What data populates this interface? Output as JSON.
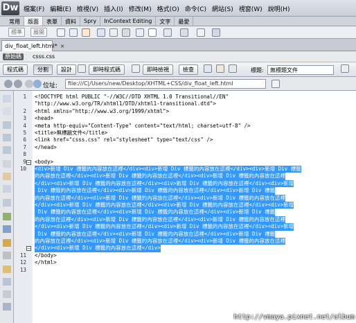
{
  "app": {
    "logo": "Dw"
  },
  "menu": [
    "檔案(F)",
    "編輯(E)",
    "檢視(V)",
    "插入(I)",
    "修改(M)",
    "格式(O)",
    "命令(C)",
    "網站(S)",
    "視窗(W)",
    "說明(H)"
  ],
  "insert_tabs": [
    "常用",
    "版面",
    "表單",
    "資料",
    "Spry",
    "InContext Editing",
    "文字",
    "最愛"
  ],
  "insert_bar": {
    "mode_button": "標準",
    "expand_button": "展開"
  },
  "document_tab": {
    "filename": "div_float_left.html*",
    "close": "×"
  },
  "related_files": {
    "source": "原始碼",
    "css": "csss.css"
  },
  "doc_toolbar": {
    "code": "程式碼",
    "split": "分割",
    "design": "設計",
    "live_code": "即時程式碼",
    "live_view": "即時檢視",
    "inspect": "檢查",
    "title_label": "標題:",
    "title_value": "無標題文件"
  },
  "address": {
    "label": "位址:",
    "value": "file:///C|/Users/new/Desktop/XHTML+CSS/div_float_left.html"
  },
  "code_lines": [
    {
      "n": "1",
      "t": "<!DOCTYPE html PUBLIC \"-//W3C//DTD XHTML 1.0 Transitional//EN\""
    },
    {
      "n": "",
      "t": "\"http://www.w3.org/TR/xhtml1/DTD/xhtml1-transitional.dtd\">"
    },
    {
      "n": "2",
      "t": "<html xmlns=\"http://www.w3.org/1999/xhtml\">"
    },
    {
      "n": "3",
      "t": "<head>"
    },
    {
      "n": "4",
      "t": "<meta http-equiv=\"Content-Type\" content=\"text/html; charset=utf-8\" />"
    },
    {
      "n": "5",
      "t": "<title>無標題文件</title>"
    },
    {
      "n": "6",
      "t": "<link href=\"csss.css\" rel=\"stylesheet\" type=\"text/css\" />"
    },
    {
      "n": "7",
      "t": "</head>"
    },
    {
      "n": "8",
      "t": ""
    },
    {
      "n": "9",
      "t": "<body>"
    },
    {
      "n": "10",
      "t": "<div>新增 Div 標籤的內容放在這裡</div><div>新增 Div 標籤的內容放在這裡</div><div>新增 Div 標籤",
      "sel": true
    },
    {
      "n": "",
      "t": "的內容放在這裡</div><div>新增 Div 標籤的內容放在這裡</div><div>新增 Div 標籤的內容放在這裡",
      "sel": true
    },
    {
      "n": "",
      "t": "</div><div>新增 Div 標籤的內容放在這裡</div><div>新增 Div 標籤的內容放在這裡</div><div>新增",
      "sel": true
    },
    {
      "n": "",
      "t": " Div 標籤的內容放在這裡</div><div>新增 Div 標籤的內容放在這裡</div><div>新增 Div 標籤",
      "sel": true
    },
    {
      "n": "",
      "t": "的內容放在這裡</div><div>新增 Div 標籤的內容放在這裡</div><div>新增 Div 標籤的內容放在這裡",
      "sel": true
    },
    {
      "n": "",
      "t": "</div><div>新增 Div 標籤的內容放在這裡</div><div>新增 Div 標籤的內容放在這裡</div><div>新增",
      "sel": true
    },
    {
      "n": "",
      "t": " Div 標籤的內容放在這裡</div><div>新增 Div 標籤的內容放在這裡</div><div>新增 Div 標籤",
      "sel": true
    },
    {
      "n": "",
      "t": "的內容放在這裡</div><div>新增 Div 標籤的內容放在這裡</div><div>新增 Div 標籤的內容放在這裡",
      "sel": true
    },
    {
      "n": "",
      "t": "</div><div>新增 Div 標籤的內容放在這裡</div><div>新增 Div 標籤的內容放在這裡</div><div>新增",
      "sel": true
    },
    {
      "n": "",
      "t": " Div 標籤的內容放在這裡</div><div>新增 Div 標籤的內容放在這裡</div><div>新增 Div 標籤",
      "sel": true
    },
    {
      "n": "",
      "t": "的內容放在這裡</div><div>新增 Div 標籤的內容放在這裡</div><div>新增 Div 標籤的內容放在這裡",
      "sel": true
    },
    {
      "n": "",
      "t": "</div><div>新增 Div 標籤的內容放在這裡</div>",
      "sel": true
    },
    {
      "n": "11",
      "t": "</body>"
    },
    {
      "n": "12",
      "t": "</html>"
    },
    {
      "n": "13",
      "t": ""
    }
  ],
  "watermark": "http://vmaya.pixnet.net/album"
}
